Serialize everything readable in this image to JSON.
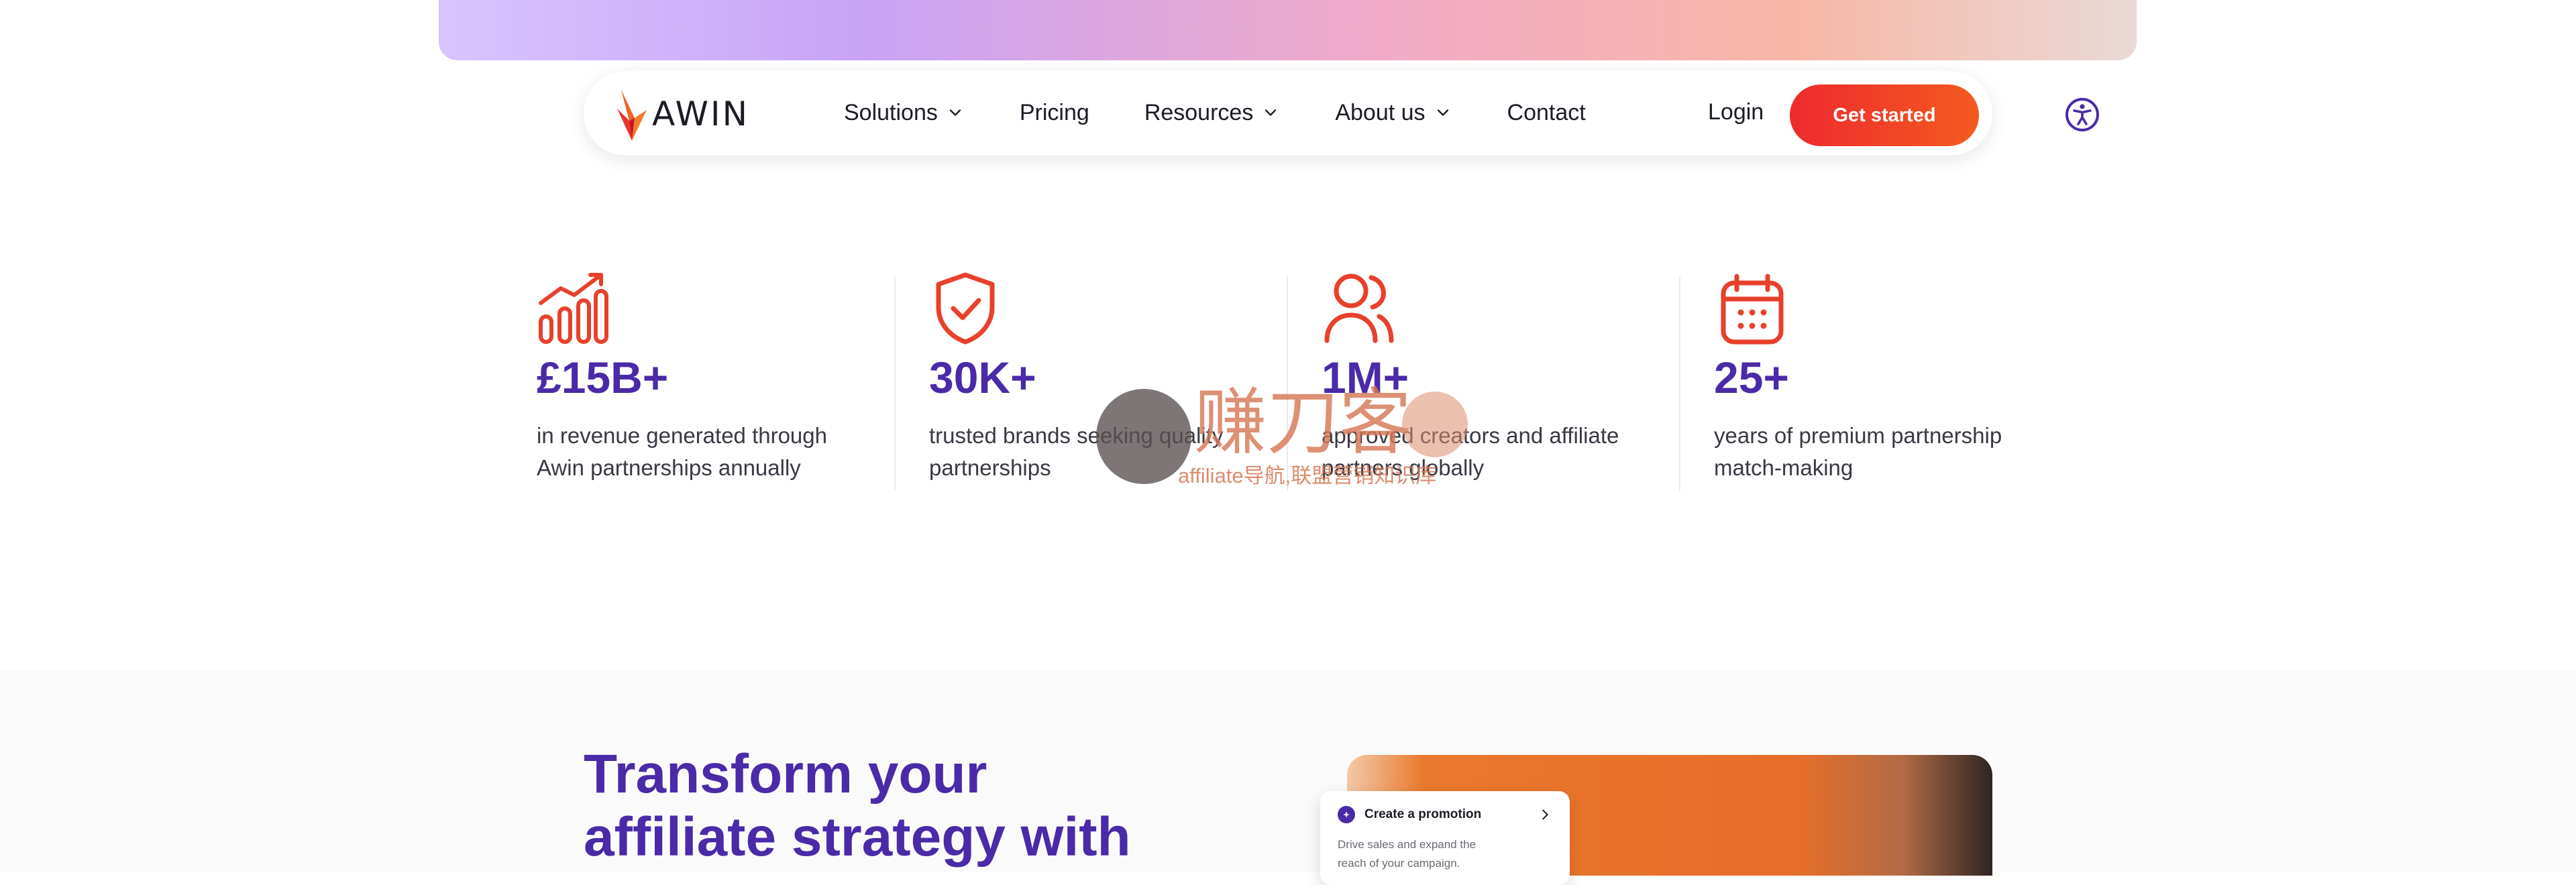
{
  "brand": {
    "name": "AWIN",
    "accent": "#4a2aa8",
    "cta_color": "#ef3a2a",
    "icon_color": "#e8402c"
  },
  "nav": {
    "items": [
      {
        "label": "Solutions",
        "has_dropdown": true
      },
      {
        "label": "Pricing",
        "has_dropdown": false
      },
      {
        "label": "Resources",
        "has_dropdown": true
      },
      {
        "label": "About us",
        "has_dropdown": true
      },
      {
        "label": "Contact",
        "has_dropdown": false
      }
    ],
    "login_label": "Login",
    "cta_label": "Get started",
    "accessibility_icon": "accessibility-icon"
  },
  "stats": [
    {
      "icon": "growth-chart-icon",
      "value": "£15B+",
      "description": "in revenue generated through Awin partnerships annually"
    },
    {
      "icon": "shield-check-icon",
      "value": "30K+",
      "description": "trusted brands seeking quality partnerships"
    },
    {
      "icon": "users-icon",
      "value": "1M+",
      "description": "approved creators and affiliate partners globally"
    },
    {
      "icon": "calendar-icon",
      "value": "25+",
      "description": "years of premium partnership match-making"
    }
  ],
  "section2": {
    "headline": "Transform your affiliate strategy with",
    "promo_card": {
      "title": "Create a promotion",
      "text": "Drive sales and expand the reach of your campaign."
    }
  },
  "watermark": {
    "title": "赚刀客",
    "subtitle": "affiliate导航,联盟营销知识库"
  }
}
